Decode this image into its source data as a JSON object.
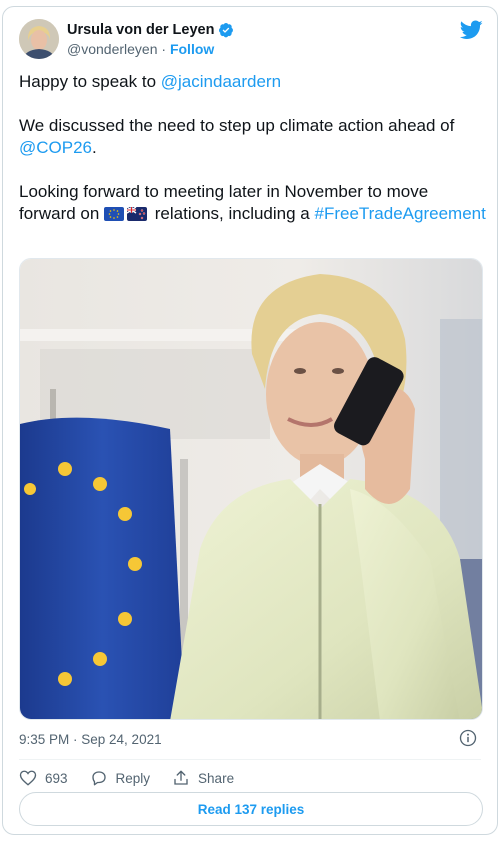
{
  "author": {
    "name": "Ursula von der Leyen",
    "handle": "@vonderleyen",
    "separator": "·",
    "follow_label": "Follow"
  },
  "tweet": {
    "line1_text": "Happy to speak to ",
    "line1_mention": "@jacindaardern",
    "line2_text": "We discussed the need to step up climate action ahead of ",
    "line2_mention": "@COP26",
    "line2_end": ".",
    "line3_text_a": "Looking forward to meeting later in November to move forward on ",
    "line3_text_b": " relations, including a ",
    "line3_hashtag": "#FreeTradeAgreement",
    "flags": [
      "eu-flag-icon",
      "new-zealand-flag-icon"
    ]
  },
  "meta": {
    "timestamp": "9:35 PM · Sep 24, 2021"
  },
  "actions": {
    "like_count": "693",
    "reply_label": "Reply",
    "share_label": "Share"
  },
  "footer": {
    "read_replies_label": "Read 137 replies"
  },
  "colors": {
    "link": "#1d9bf0",
    "text": "#0f1419",
    "muted": "#536471",
    "border": "#cfd9de"
  }
}
